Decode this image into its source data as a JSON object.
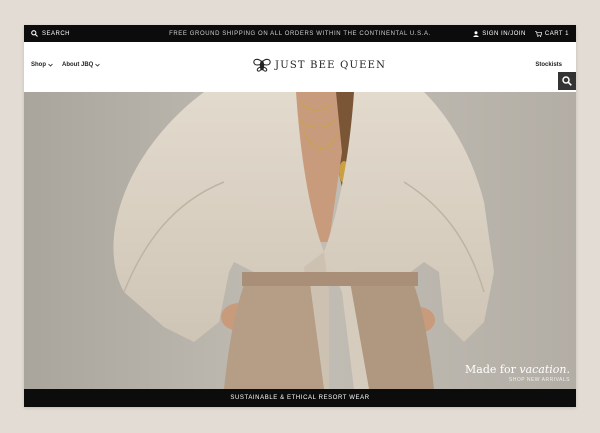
{
  "topbar": {
    "search_label": "SEARCH",
    "promo": "FREE GROUND SHIPPING ON ALL ORDERS WITHIN THE CONTINENTAL U.S.A.",
    "signin_label": "SIGN IN/JOIN",
    "cart_label": "CART 1"
  },
  "header": {
    "nav": [
      {
        "label": "Shop"
      },
      {
        "label": "About JBQ"
      }
    ],
    "logo_text": "JUST BEE QUEEN",
    "stockists_label": "Stockists"
  },
  "hero": {
    "caption_prefix": "Made for ",
    "caption_emphasis": "vacation.",
    "caption_link": "SHOP NEW ARRIVALS"
  },
  "bottombar": {
    "text": "SUSTAINABLE & ETHICAL RESORT WEAR"
  },
  "colors": {
    "bar": "#0c0c0c",
    "page_bg": "#e3dcd4",
    "hero_bg": "#bdb8af",
    "blouse": "#d9d0c3",
    "trousers": "#b59d86"
  },
  "icons": [
    "search-icon",
    "user-icon",
    "cart-icon",
    "chevron-down-icon",
    "bee-logo-icon"
  ]
}
